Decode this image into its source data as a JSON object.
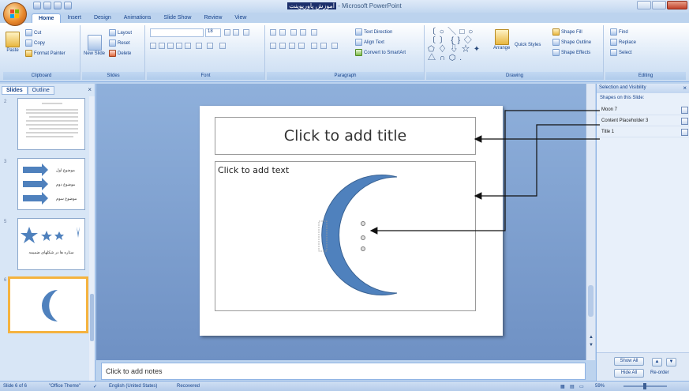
{
  "titlebar": {
    "doc_title": "آموزش پاورپوینت",
    "app_title": "- Microsoft PowerPoint"
  },
  "tabs": [
    "Home",
    "Insert",
    "Design",
    "Animations",
    "Slide Show",
    "Review",
    "View"
  ],
  "ribbon": {
    "clipboard": {
      "label": "Clipboard",
      "paste": "Paste",
      "cut": "Cut",
      "copy": "Copy",
      "format_painter": "Format Painter"
    },
    "slides": {
      "label": "Slides",
      "new_slide": "New Slide",
      "layout": "Layout",
      "reset": "Reset",
      "delete": "Delete"
    },
    "font": {
      "label": "Font",
      "size": "18"
    },
    "paragraph": {
      "label": "Paragraph",
      "text_direction": "Text Direction",
      "align_text": "Align Text",
      "convert_smartart": "Convert to SmartArt"
    },
    "drawing": {
      "label": "Drawing",
      "arrange": "Arrange",
      "quick_styles": "Quick Styles",
      "shape_fill": "Shape Fill",
      "shape_outline": "Shape Outline",
      "shape_effects": "Shape Effects",
      "shapes_glyphs": "〔 ○ ╲ □ ○ 〔  〕 { } ◇ ⬠ ♢ ⇩ ☆ ✦ △ ∩ ⬡ ."
    },
    "editing": {
      "label": "Editing",
      "find": "Find",
      "replace": "Replace",
      "select": "Select"
    }
  },
  "left_pane": {
    "tab_slides": "Slides",
    "tab_outline": "Outline",
    "close": "×",
    "thumbnails": [
      {
        "num": "2"
      },
      {
        "num": "3",
        "lines": [
          "موضوع اول",
          "موضوع دوم",
          "موضوع سوم"
        ]
      },
      {
        "num": "5",
        "caption": "ستاره ها در شکلهای ضمیمه"
      },
      {
        "num": "6"
      }
    ]
  },
  "slide": {
    "title_placeholder": "Click to add title",
    "content_placeholder": "Click to add text",
    "moon_color": "#4f81bd"
  },
  "notes": {
    "placeholder": "Click to add notes"
  },
  "selection_pane": {
    "title": "Selection and Visibility",
    "close": "×",
    "subtitle": "Shapes on this Slide:",
    "items": [
      "Moon 7",
      "Content Placeholder 3",
      "Title 1"
    ],
    "show_all": "Show All",
    "hide_all": "Hide All",
    "reorder": "Re-order",
    "up": "▲",
    "down": "▼"
  },
  "statusbar": {
    "slide_info": "Slide 6 of 6",
    "theme": "\"Office Theme\"",
    "language": "English (United States)",
    "mode": "Recovered",
    "zoom": "59%"
  },
  "colors": {
    "accent": "#f5b33f",
    "ribbon_text": "#15428b",
    "canvas_bg": "#7f9fd1"
  }
}
